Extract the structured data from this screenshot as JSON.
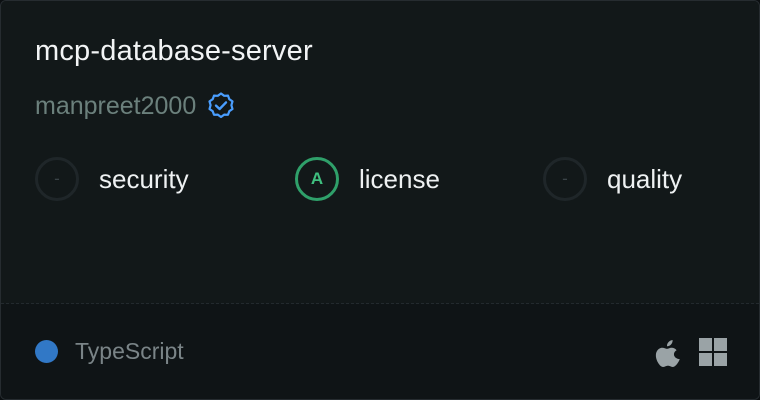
{
  "server": {
    "name": "mcp-database-server",
    "author": "manpreet2000",
    "verified_icon": "verified-badge-icon"
  },
  "scores": [
    {
      "grade": "-",
      "label": "security",
      "status": "empty"
    },
    {
      "grade": "A",
      "label": "license",
      "status": "pass"
    },
    {
      "grade": "-",
      "label": "quality",
      "status": "empty"
    }
  ],
  "footer": {
    "language": "TypeScript",
    "language_color": "#3178c6",
    "platforms": [
      "apple-icon",
      "windows-icon"
    ]
  },
  "colors": {
    "accent_verified": "#4a9eff",
    "grade_a": "#2fa06a",
    "background": "#121819"
  }
}
